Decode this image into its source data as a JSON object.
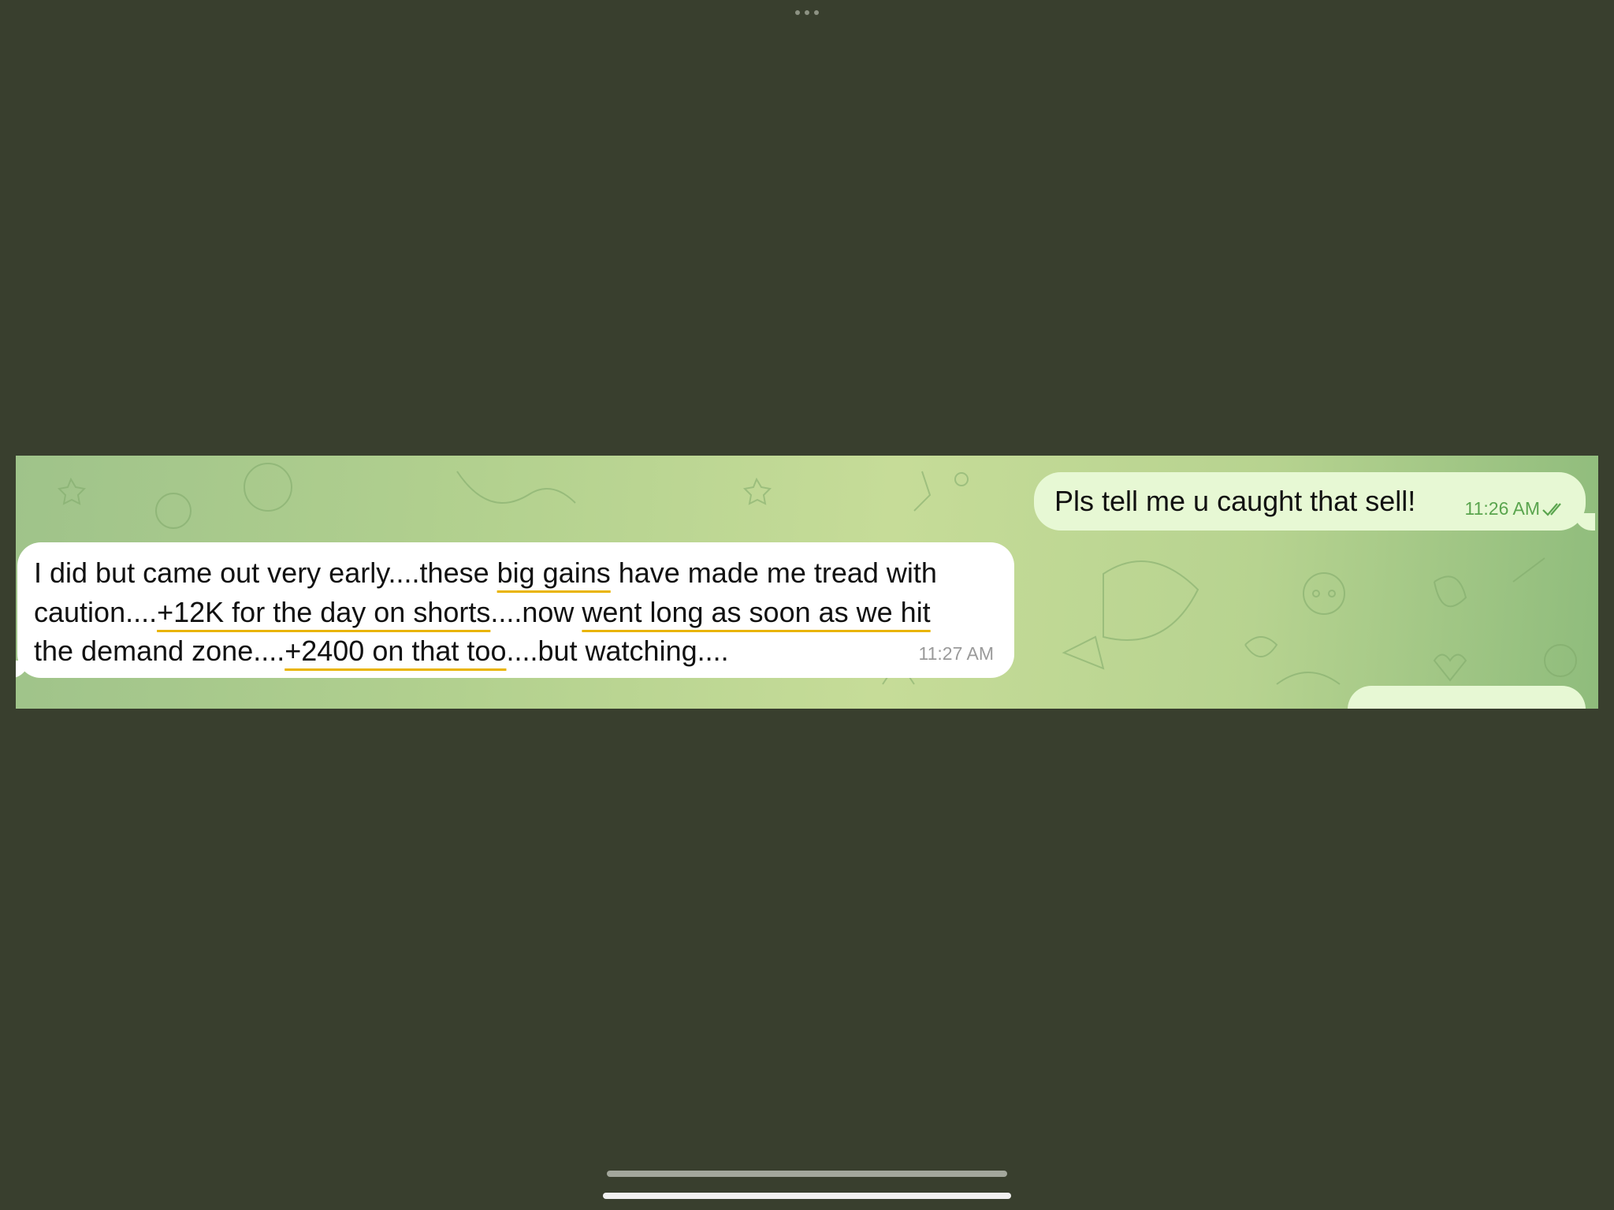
{
  "messages": {
    "outgoing": {
      "text": "Pls tell me u caught that sell!",
      "time": "11:26 AM",
      "status_icon": "double-check-icon"
    },
    "incoming": {
      "line1_a": "I did but came out very early....these ",
      "line1_ul": "big gains",
      "line1_b": " have made me tread with",
      "line2_a": "caution....",
      "line2_ul": "+12K for the day on shorts",
      "line2_b": "....now ",
      "line2_ul2": "went long as soon as we hit",
      "line3_a": "the demand zone....",
      "line3_ul": "+2400 on that too",
      "line3_b": "....but watching....",
      "time": "11:27 AM"
    }
  },
  "colors": {
    "background": "#393f2e",
    "outgoing_bubble": "#e7f8d4",
    "incoming_bubble": "#ffffff",
    "underline_highlight": "#e9b400",
    "outgoing_time": "#5aa54e"
  }
}
